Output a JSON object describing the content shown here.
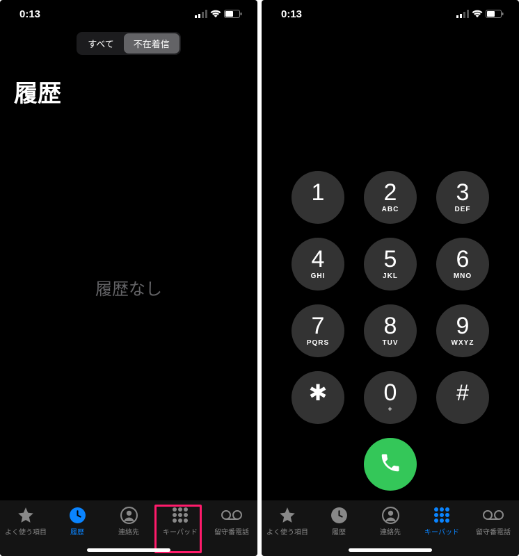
{
  "status": {
    "time": "0:13"
  },
  "left_screen": {
    "seg": {
      "all": "すべて",
      "missed": "不在着信"
    },
    "title": "履歴",
    "empty": "履歴なし"
  },
  "tabs": {
    "favorites": "よく使う項目",
    "recents": "履歴",
    "contacts": "連絡先",
    "keypad": "キーパッド",
    "voicemail": "留守番電話"
  },
  "keypad": {
    "keys": [
      {
        "d": "1",
        "l": ""
      },
      {
        "d": "2",
        "l": "ABC"
      },
      {
        "d": "3",
        "l": "DEF"
      },
      {
        "d": "4",
        "l": "GHI"
      },
      {
        "d": "5",
        "l": "JKL"
      },
      {
        "d": "6",
        "l": "MNO"
      },
      {
        "d": "7",
        "l": "PQRS"
      },
      {
        "d": "8",
        "l": "TUV"
      },
      {
        "d": "9",
        "l": "WXYZ"
      },
      {
        "d": "✱",
        "l": ""
      },
      {
        "d": "0",
        "l": "+"
      },
      {
        "d": "#",
        "l": ""
      }
    ]
  }
}
